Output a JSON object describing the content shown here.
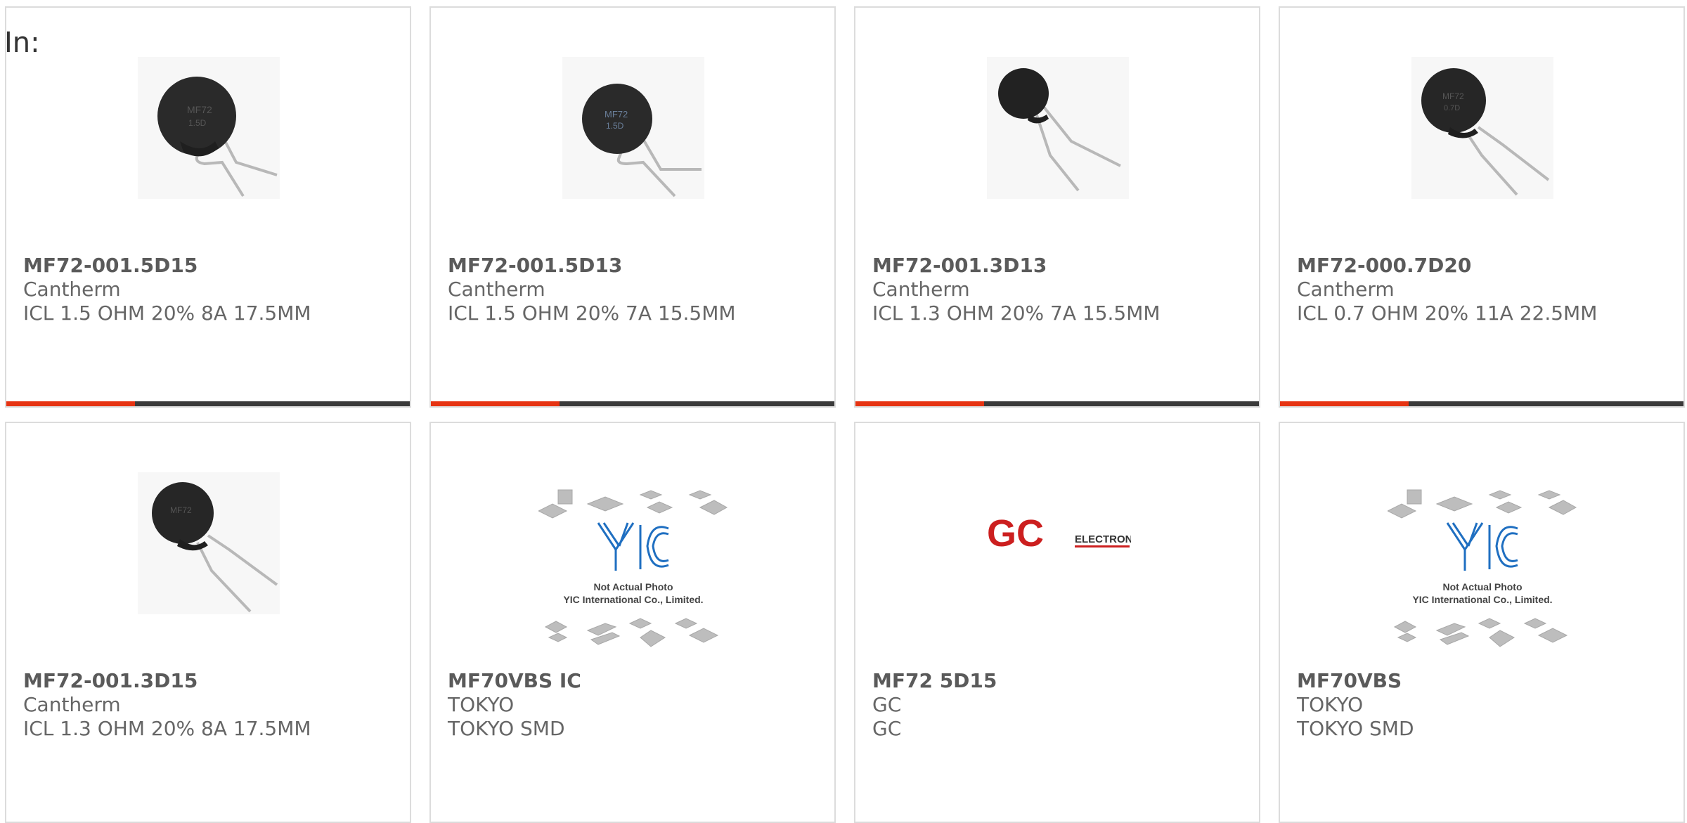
{
  "filter": {
    "label": "In:"
  },
  "colors": {
    "accent": "#e63312",
    "bar": "#3a3a3a",
    "border": "#dcdcdc"
  },
  "products": [
    {
      "part": "MF72-001.5D15",
      "maker": "Cantherm",
      "desc": "ICL 1.5 OHM 20% 8A 17.5MM",
      "image": "thermistor-photo"
    },
    {
      "part": "MF72-001.5D13",
      "maker": "Cantherm",
      "desc": "ICL 1.5 OHM 20% 7A 15.5MM",
      "image": "thermistor-photo"
    },
    {
      "part": "MF72-001.3D13",
      "maker": "Cantherm",
      "desc": "ICL 1.3 OHM 20% 7A 15.5MM",
      "image": "thermistor-photo"
    },
    {
      "part": "MF72-000.7D20",
      "maker": "Cantherm",
      "desc": "ICL 0.7 OHM 20% 11A 22.5MM",
      "image": "thermistor-photo"
    },
    {
      "part": "MF72-001.3D15",
      "maker": "Cantherm",
      "desc": "ICL 1.3 OHM 20% 8A 17.5MM",
      "image": "thermistor-photo"
    },
    {
      "part": "MF70VBS IC",
      "maker": "TOKYO",
      "desc": "TOKYO SMD",
      "image": "yic-placeholder",
      "placeholder_text": {
        "logo": "YIC",
        "line1": "Not Actual Photo",
        "line2": "YIC International Co., Limited."
      }
    },
    {
      "part": "MF72 5D15",
      "maker": "GC",
      "desc": "GC",
      "image": "gc-logo",
      "logo_text": {
        "main": "GC",
        "sub": "ELECTRONICS"
      }
    },
    {
      "part": "MF70VBS",
      "maker": "TOKYO",
      "desc": "TOKYO SMD",
      "image": "yic-placeholder",
      "placeholder_text": {
        "logo": "YIC",
        "line1": "Not Actual Photo",
        "line2": "YIC International Co., Limited."
      }
    }
  ]
}
